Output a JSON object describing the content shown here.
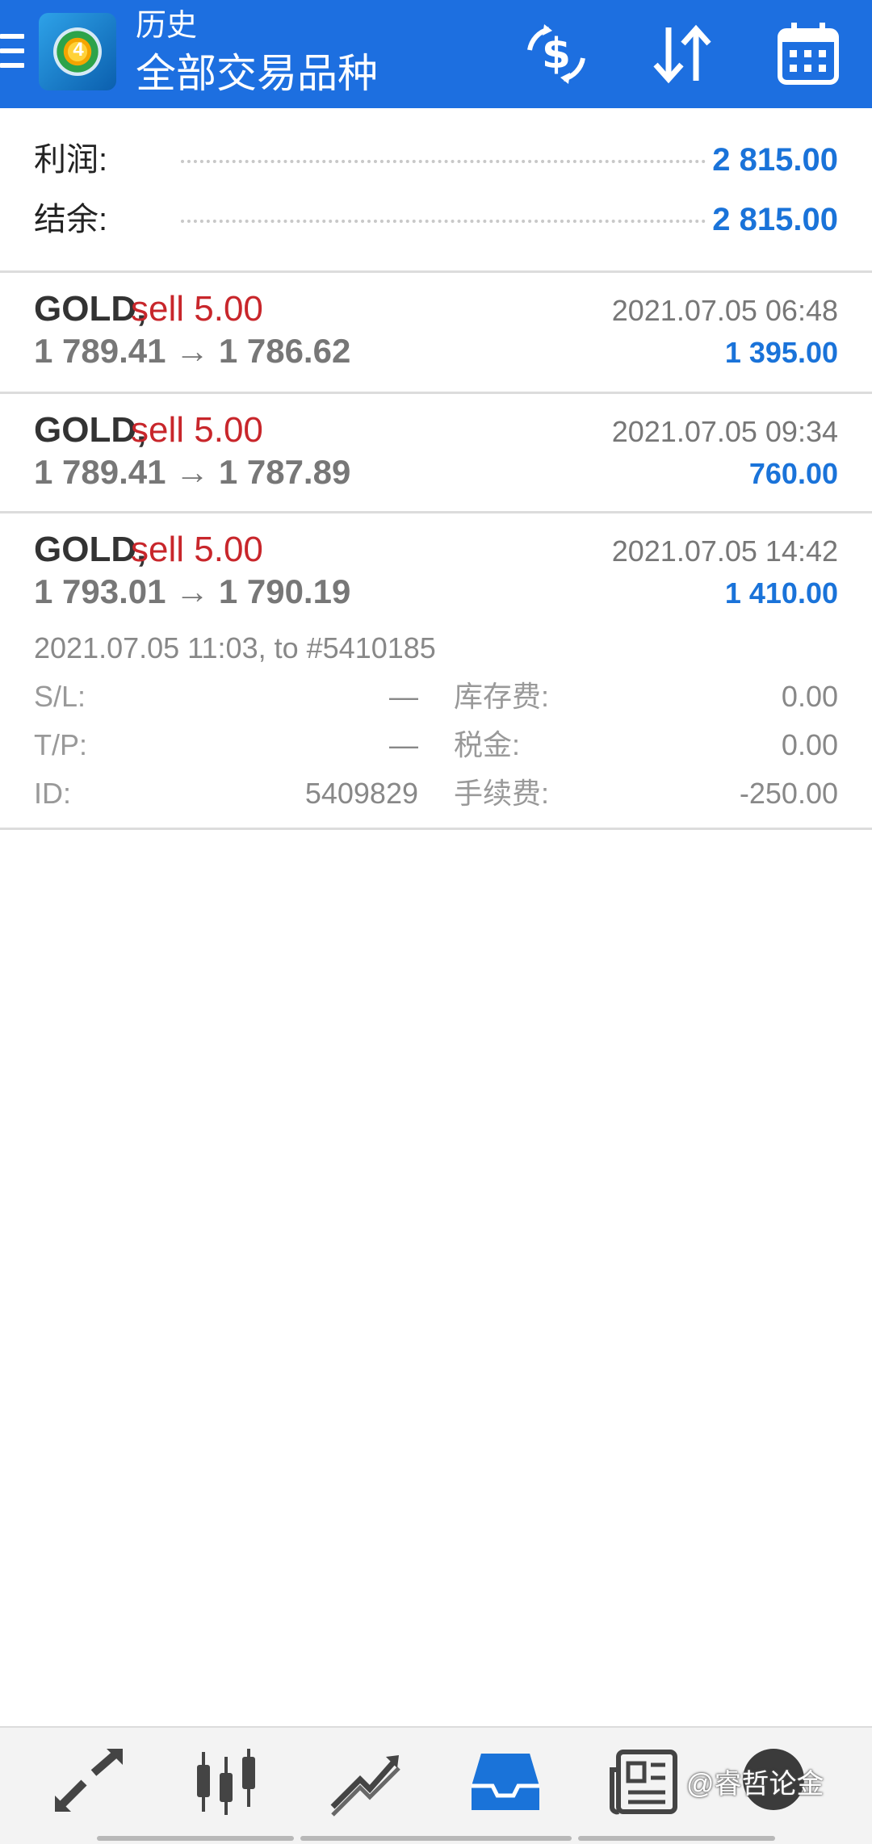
{
  "header": {
    "title_small": "历史",
    "title_big": "全部交易品种",
    "background": "#1d6fe0",
    "icons": [
      "menu-icon",
      "app-logo-icon",
      "currency-exchange-icon",
      "sort-icon",
      "calendar-icon"
    ]
  },
  "summary": {
    "profit_label": "利润:",
    "profit_value": "2 815.00",
    "balance_label": "结余:",
    "balance_value": "2 815.00",
    "value_color": "#1a73d9"
  },
  "deals": [
    {
      "symbol": "GOLD,",
      "side": "sell 5.00",
      "time": "2021.07.05 06:48",
      "prices": "1 789.41 → 1 786.62",
      "profit": "1 395.00"
    },
    {
      "symbol": "GOLD,",
      "side": "sell 5.00",
      "time": "2021.07.05 09:34",
      "prices": "1 789.41 → 1 787.89",
      "profit": "760.00"
    },
    {
      "symbol": "GOLD,",
      "side": "sell 5.00",
      "time": "2021.07.05 14:42",
      "prices": "1 793.01 → 1 790.19",
      "profit": "1 410.00",
      "details": {
        "open_info": "2021.07.05 11:03, to #5410185",
        "sl_label": "S/L:",
        "sl_value": "—",
        "tp_label": "T/P:",
        "tp_value": "—",
        "id_label": "ID:",
        "id_value": "5409829",
        "swap_label": "库存费:",
        "swap_value": "0.00",
        "tax_label": "税金:",
        "tax_value": "0.00",
        "commission_label": "手续费:",
        "commission_value": "-250.00"
      }
    }
  ],
  "bottom_nav": {
    "items": [
      "quotes-icon",
      "chart-icon",
      "trade-icon",
      "history-icon",
      "news-icon"
    ],
    "active": "history-icon",
    "active_color": "#1a73d9",
    "watermark": "@睿哲论金"
  }
}
